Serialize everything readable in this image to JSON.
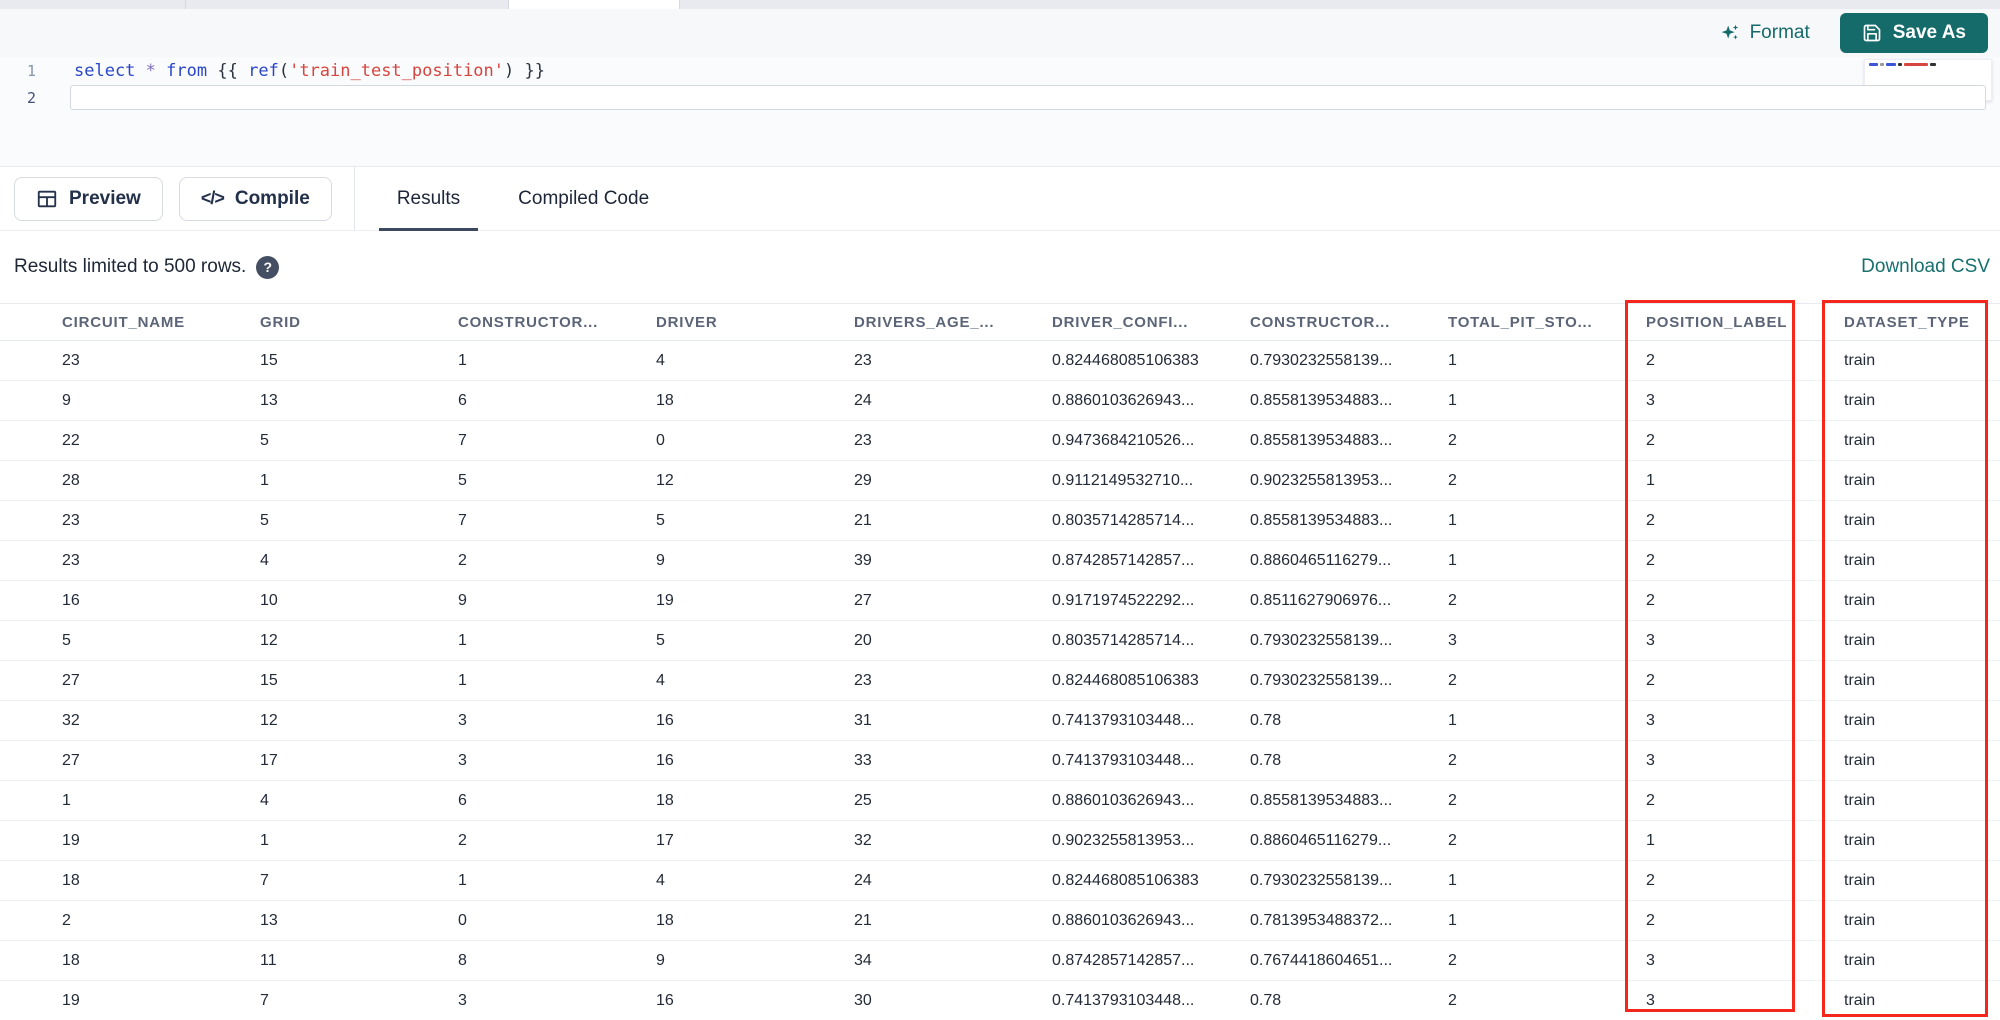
{
  "editor": {
    "toolbar": {
      "format_label": "Format",
      "save_as_label": "Save As"
    },
    "lines": [
      {
        "number": "1"
      },
      {
        "number": "2"
      }
    ],
    "code_line": "select * from {{ ref('train_test_position') }}",
    "code_tokens": [
      {
        "type": "kw",
        "text": "select"
      },
      {
        "type": "plain",
        "text": " "
      },
      {
        "type": "star",
        "text": "*"
      },
      {
        "type": "plain",
        "text": " "
      },
      {
        "type": "kw",
        "text": "from"
      },
      {
        "type": "plain",
        "text": " "
      },
      {
        "type": "brace",
        "text": "{{"
      },
      {
        "type": "plain",
        "text": " "
      },
      {
        "type": "fn",
        "text": "ref"
      },
      {
        "type": "brace",
        "text": "("
      },
      {
        "type": "str",
        "text": "'train_test_position'"
      },
      {
        "type": "brace",
        "text": ")"
      },
      {
        "type": "plain",
        "text": " "
      },
      {
        "type": "brace",
        "text": "}}"
      }
    ]
  },
  "actions": {
    "preview_label": "Preview",
    "compile_label": "Compile",
    "compile_icon_glyph": "</>"
  },
  "tabs": [
    {
      "label": "Results",
      "active": true
    },
    {
      "label": "Compiled Code",
      "active": false
    }
  ],
  "results": {
    "limit_note": "Results limited to 500 rows.",
    "help_icon_glyph": "?",
    "download_csv_label": "Download CSV",
    "columns": [
      "CIRCUIT_NAME",
      "GRID",
      "CONSTRUCTOR...",
      "DRIVER",
      "DRIVERS_AGE_...",
      "DRIVER_CONFI...",
      "CONSTRUCTOR...",
      "TOTAL_PIT_STO...",
      "POSITION_LABEL",
      "DATASET_TYPE"
    ],
    "rows": [
      [
        "23",
        "15",
        "1",
        "4",
        "23",
        "0.824468085106383",
        "0.7930232558139...",
        "1",
        "2",
        "train"
      ],
      [
        "9",
        "13",
        "6",
        "18",
        "24",
        "0.8860103626943...",
        "0.8558139534883...",
        "1",
        "3",
        "train"
      ],
      [
        "22",
        "5",
        "7",
        "0",
        "23",
        "0.9473684210526...",
        "0.8558139534883...",
        "2",
        "2",
        "train"
      ],
      [
        "28",
        "1",
        "5",
        "12",
        "29",
        "0.9112149532710...",
        "0.9023255813953...",
        "2",
        "1",
        "train"
      ],
      [
        "23",
        "5",
        "7",
        "5",
        "21",
        "0.8035714285714...",
        "0.8558139534883...",
        "1",
        "2",
        "train"
      ],
      [
        "23",
        "4",
        "2",
        "9",
        "39",
        "0.8742857142857...",
        "0.8860465116279...",
        "1",
        "2",
        "train"
      ],
      [
        "16",
        "10",
        "9",
        "19",
        "27",
        "0.9171974522292...",
        "0.8511627906976...",
        "2",
        "2",
        "train"
      ],
      [
        "5",
        "12",
        "1",
        "5",
        "20",
        "0.8035714285714...",
        "0.7930232558139...",
        "3",
        "3",
        "train"
      ],
      [
        "27",
        "15",
        "1",
        "4",
        "23",
        "0.824468085106383",
        "0.7930232558139...",
        "2",
        "2",
        "train"
      ],
      [
        "32",
        "12",
        "3",
        "16",
        "31",
        "0.7413793103448...",
        "0.78",
        "1",
        "3",
        "train"
      ],
      [
        "27",
        "17",
        "3",
        "16",
        "33",
        "0.7413793103448...",
        "0.78",
        "2",
        "3",
        "train"
      ],
      [
        "1",
        "4",
        "6",
        "18",
        "25",
        "0.8860103626943...",
        "0.8558139534883...",
        "2",
        "2",
        "train"
      ],
      [
        "19",
        "1",
        "2",
        "17",
        "32",
        "0.9023255813953...",
        "0.8860465116279...",
        "2",
        "1",
        "train"
      ],
      [
        "18",
        "7",
        "1",
        "4",
        "24",
        "0.824468085106383",
        "0.7930232558139...",
        "1",
        "2",
        "train"
      ],
      [
        "2",
        "13",
        "0",
        "18",
        "21",
        "0.8860103626943...",
        "0.7813953488372...",
        "1",
        "2",
        "train"
      ],
      [
        "18",
        "11",
        "8",
        "9",
        "34",
        "0.8742857142857...",
        "0.7674418604651...",
        "2",
        "3",
        "train"
      ],
      [
        "19",
        "7",
        "3",
        "16",
        "30",
        "0.7413793103448...",
        "0.78",
        "2",
        "3",
        "train"
      ]
    ],
    "highlighted_columns": [
      "POSITION_LABEL",
      "DATASET_TYPE"
    ]
  },
  "colors": {
    "accent_teal": "#156a6a",
    "highlight_red": "#f5261b",
    "keyword_blue": "#2a46c9",
    "string_red": "#d6453e",
    "tab_underline": "#3c485f"
  }
}
